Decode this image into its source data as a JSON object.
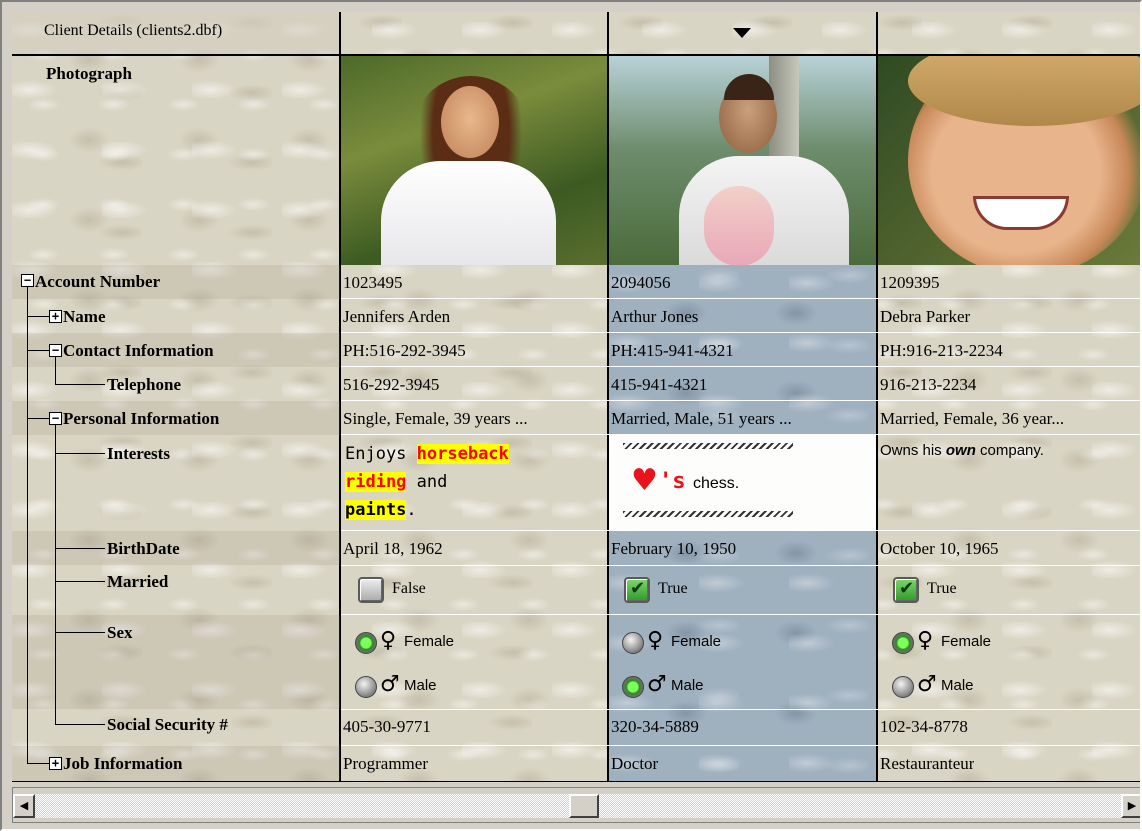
{
  "header": {
    "title": "Client Details (clients2.dbf)",
    "sort_icon": "sort-down-arrow-icon"
  },
  "labels": {
    "photograph": "Photograph",
    "account": "Account Number",
    "name": "Name",
    "contact": "Contact Information",
    "telephone": "Telephone",
    "personal": "Personal Information",
    "interests": "Interests",
    "birthdate": "BirthDate",
    "married": "Married",
    "sex": "Sex",
    "ssn": "Social Security #",
    "job": "Job Information"
  },
  "clients": [
    {
      "account": "1023495",
      "name": "Jennifers Arden",
      "contact": "PH:516-292-3945",
      "telephone": "516-292-3945",
      "personal": "Single, Female, 39 years ...",
      "interests": {
        "w1": "Enjoys ",
        "w2": "horseback",
        "w3": "riding",
        "w4": " and",
        "w5": "paints",
        "w6": "."
      },
      "birthdate": "April 18, 1962",
      "married": "False",
      "married_checked": false,
      "sex_female": "Female",
      "sex_male": "Male",
      "sex_selected": "Female",
      "ssn": "405-30-9771",
      "job": "Programmer"
    },
    {
      "account": "2094056",
      "name": "Arthur Jones",
      "contact": "PH:415-941-4321",
      "telephone": "415-941-4321",
      "personal": "Married, Male, 51 years ...",
      "interests": {
        "heart": "♥",
        "s": "'s",
        "rest": " chess."
      },
      "birthdate": "February 10, 1950",
      "married": "True",
      "married_checked": true,
      "sex_female": "Female",
      "sex_male": "Male",
      "sex_selected": "Male",
      "ssn": "320-34-5889",
      "job": "Doctor"
    },
    {
      "account": "1209395",
      "name": "Debra Parker",
      "contact": "PH:916-213-2234",
      "telephone": "916-213-2234",
      "personal": "Married, Female, 36 year...",
      "interests": {
        "a": "Owns his ",
        "b": "own",
        "c": " company."
      },
      "birthdate": "October 10, 1965",
      "married": "True",
      "married_checked": true,
      "sex_female": "Female",
      "sex_male": "Male",
      "sex_selected": "Female",
      "ssn": "102-34-8778",
      "job": "Restauranteur"
    }
  ],
  "scrollbar": {
    "left_icon": "scroll-left-arrow-icon",
    "right_icon": "scroll-right-arrow-icon"
  },
  "colors": {
    "selected_column": "#9fb0bf",
    "highlight": "#ffff00",
    "highlight_text": "#ff0000"
  }
}
